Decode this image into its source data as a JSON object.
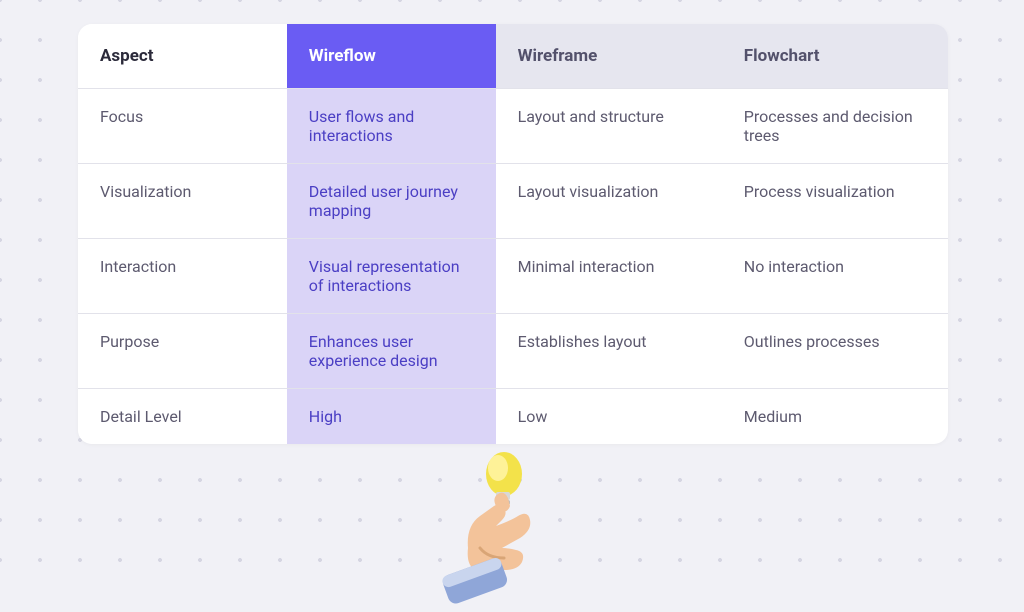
{
  "chart_data": {
    "type": "table",
    "title": "",
    "columns": [
      "Aspect",
      "Wireflow",
      "Wireframe",
      "Flowchart"
    ],
    "rows": [
      [
        "Focus",
        "User flows and interactions",
        "Layout and structure",
        "Processes and decision trees"
      ],
      [
        "Visualization",
        "Detailed user journey mapping",
        "Layout visualization",
        "Process visualization"
      ],
      [
        "Interaction",
        "Visual representation of interactions",
        "Minimal interaction",
        "No interaction"
      ],
      [
        "Purpose",
        "Enhances user experience design",
        "Establishes layout",
        "Outlines processes"
      ],
      [
        "Detail Level",
        "High",
        "Low",
        "Medium"
      ]
    ],
    "highlighted_column": "Wireflow"
  },
  "headers": {
    "aspect": "Aspect",
    "wireflow": "Wireflow",
    "wireframe": "Wireframe",
    "flowchart": "Flowchart"
  },
  "rows": [
    {
      "aspect": "Focus",
      "wireflow": "User flows and interactions",
      "wireframe": "Layout and structure",
      "flowchart": "Processes and decision trees"
    },
    {
      "aspect": "Visualization",
      "wireflow": "Detailed user journey mapping",
      "wireframe": "Layout visualization",
      "flowchart": "Process visualization"
    },
    {
      "aspect": "Interaction",
      "wireflow": "Visual representation of interactions",
      "wireframe": "Minimal interaction",
      "flowchart": "No interaction"
    },
    {
      "aspect": "Purpose",
      "wireflow": "Enhances user experience design",
      "wireframe": "Establishes layout",
      "flowchart": "Outlines processes"
    },
    {
      "aspect": "Detail Level",
      "wireflow": "High",
      "wireframe": "Low",
      "flowchart": "Medium"
    }
  ]
}
